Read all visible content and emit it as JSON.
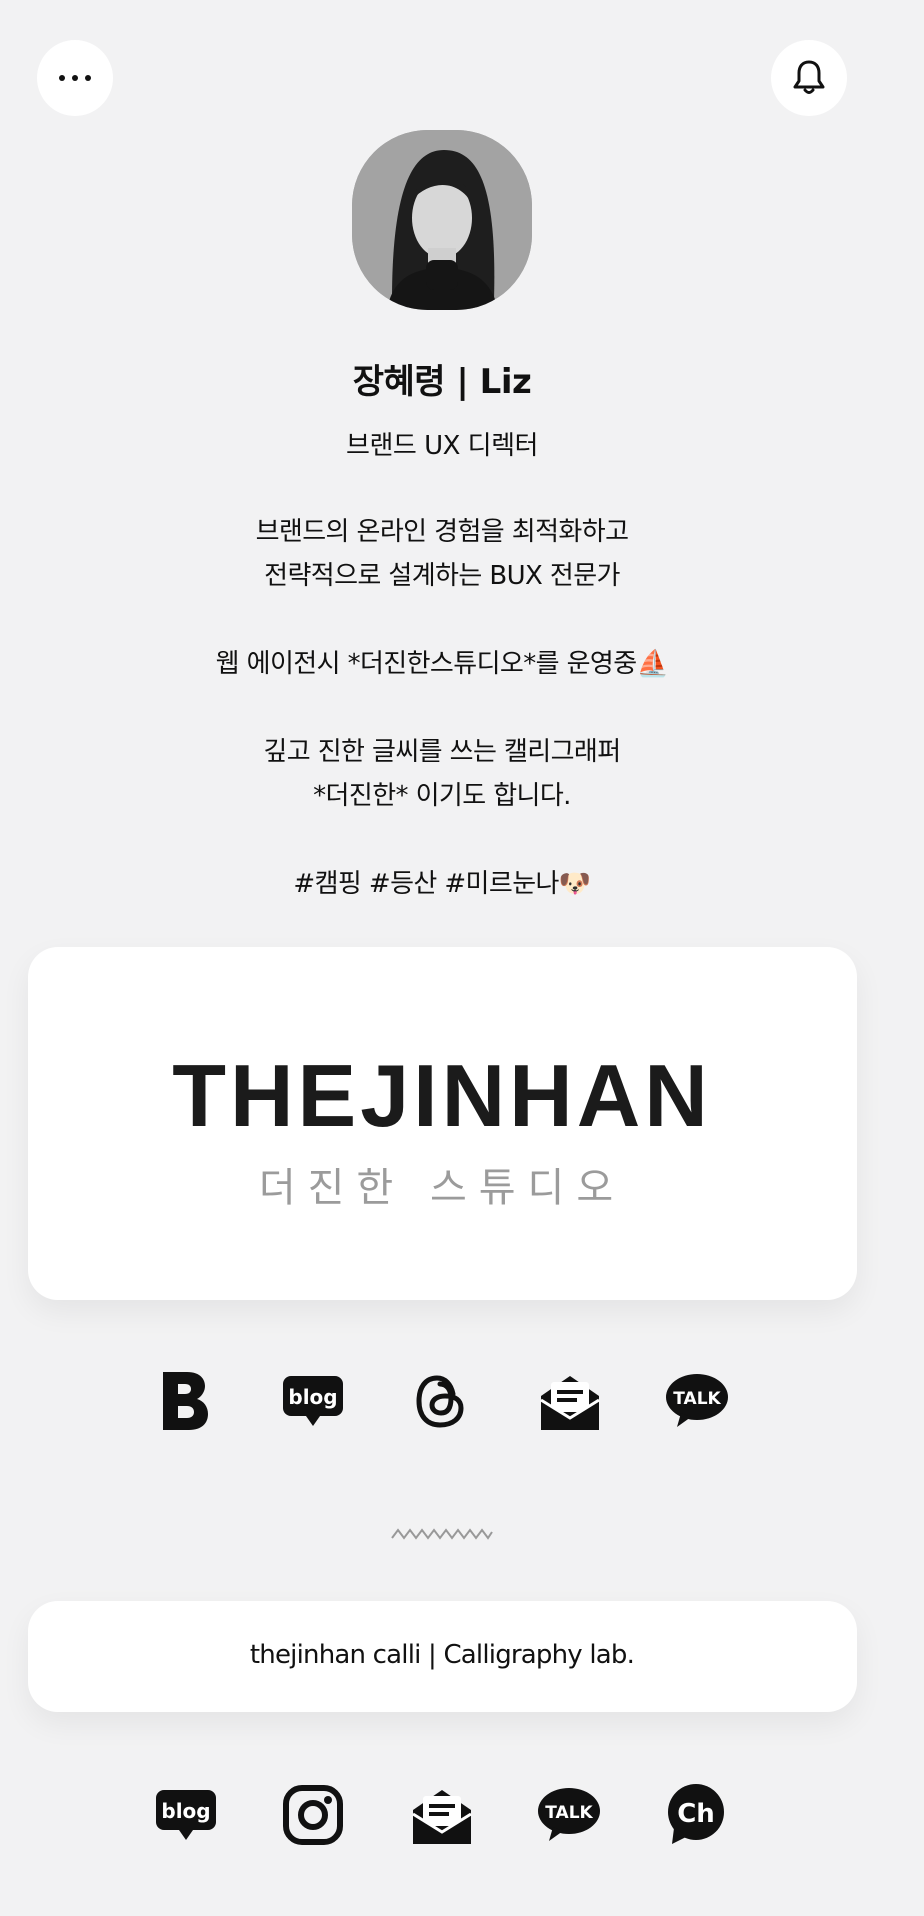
{
  "header": {
    "menu_icon": "more-horizontal-icon",
    "bell_icon": "bell-icon"
  },
  "profile": {
    "name": "장혜령 | Liz",
    "role": "브랜드 UX 디렉터",
    "bio_line1": "브랜드의 온라인 경험을 최적화하고",
    "bio_line2": "전략적으로 설계하는 BUX 전문가",
    "bio_line3": "웹 에이전시 *더진한스튜디오*를 운영중⛵",
    "bio_line4": "깊고 진한 글씨를 쓰는 캘리그래퍼",
    "bio_line5": "*더진한* 이기도 합니다.",
    "bio_line6": "#캠핑 #등산 #미르눈나🐶"
  },
  "brand_card": {
    "wordmark": "THEJINHAN",
    "subtitle": "더진한 스튜디오"
  },
  "social_row1": [
    {
      "name": "brunch-icon"
    },
    {
      "name": "naver-blog-icon",
      "label": "blog"
    },
    {
      "name": "threads-icon"
    },
    {
      "name": "newsletter-icon"
    },
    {
      "name": "kakaotalk-icon",
      "label": "TALK"
    }
  ],
  "calli_card": {
    "text": "thejinhan calli  |   Calligraphy lab."
  },
  "social_row2": [
    {
      "name": "naver-blog-icon",
      "label": "blog"
    },
    {
      "name": "instagram-icon"
    },
    {
      "name": "newsletter-icon"
    },
    {
      "name": "kakaotalk-icon",
      "label": "TALK"
    },
    {
      "name": "kakao-channel-icon",
      "label": "Ch"
    }
  ],
  "colors": {
    "background": "#f2f2f3",
    "card": "#ffffff",
    "text": "#111111",
    "muted": "#9b9b9b"
  }
}
